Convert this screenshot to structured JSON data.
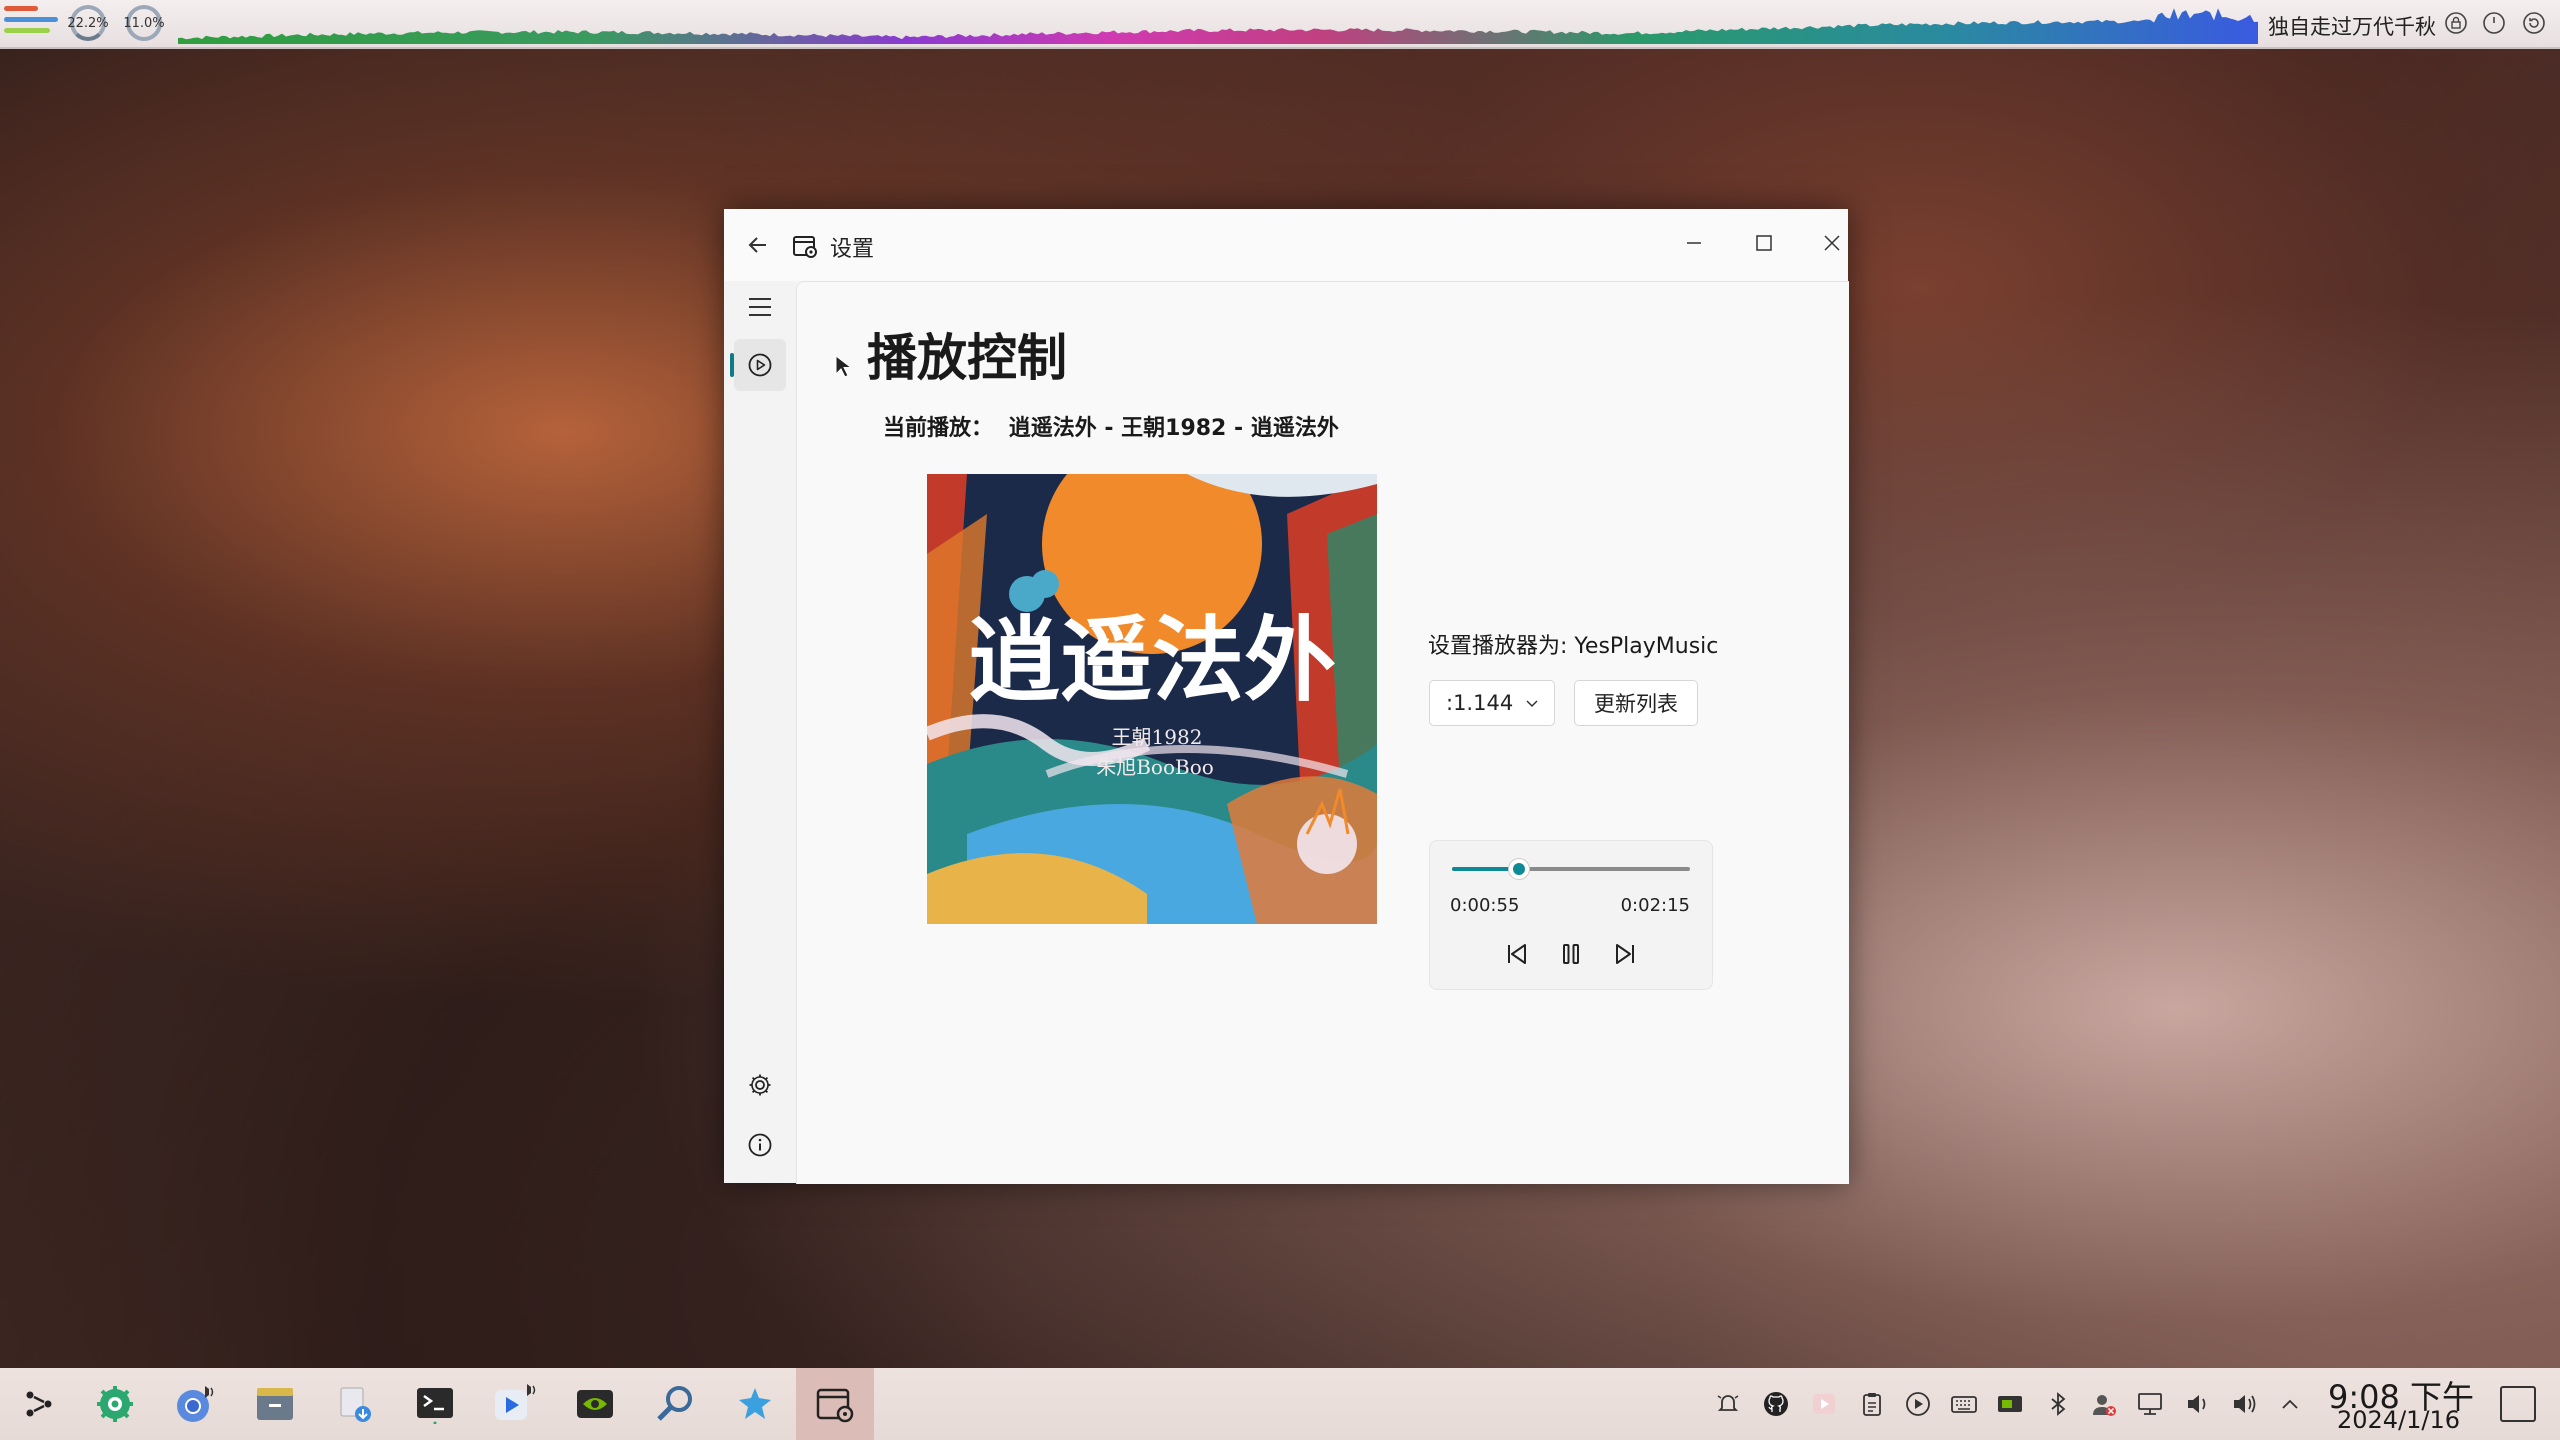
{
  "top_panel": {
    "cpu": "22.2%",
    "mem": "11.0%",
    "song_title": "独自走过万代千秋"
  },
  "window": {
    "title": "设置",
    "page_title": "播放控制",
    "now_playing_label": "当前播放：",
    "now_playing_value": "逍遥法外 - 王朝1982 - 逍遥法外",
    "album_cover": {
      "title_text": "逍遥法外",
      "artist_line1": "王朝1982",
      "artist_line2": "朱旭BooBoo"
    },
    "player_label": "设置播放器为: ",
    "player_name": "YesPlayMusic",
    "player_select_value": ":1.144",
    "refresh_button": "更新列表",
    "progress": {
      "current": "0:00:55",
      "total": "0:02:15",
      "fraction": 0.28
    }
  },
  "taskbar": {
    "clock_time": "9:08 下午",
    "clock_date": "2024/1/16"
  },
  "colors": {
    "accent": "#0e8a96"
  }
}
